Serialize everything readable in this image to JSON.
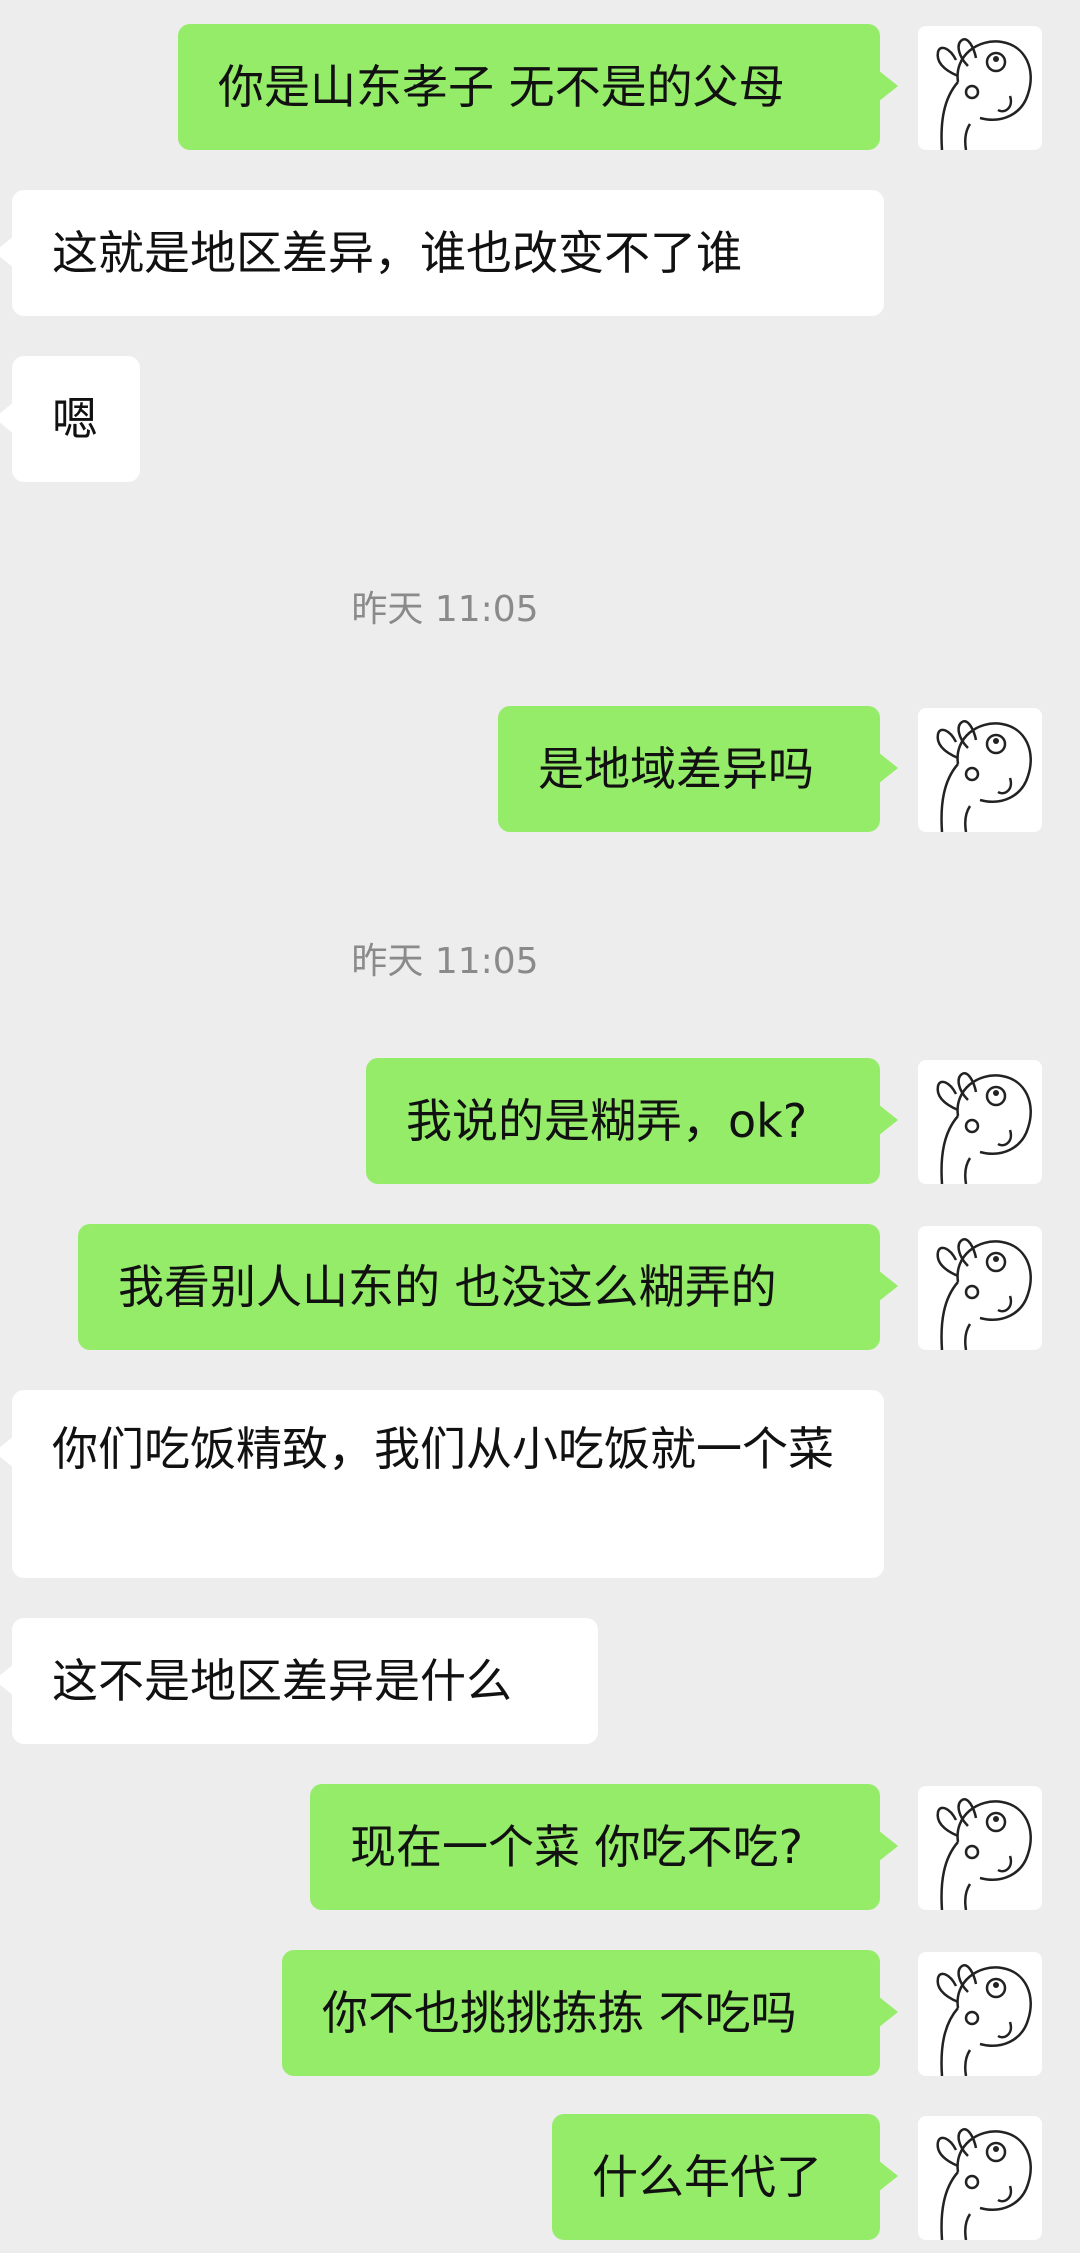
{
  "conversation": {
    "messages": [
      {
        "side": "out",
        "text": "你是山东孝子 无不是的父母"
      },
      {
        "side": "in",
        "text": "这就是地区差异，谁也改变不了谁"
      },
      {
        "side": "in",
        "text": "嗯"
      },
      {
        "type": "time",
        "text": "昨天 11:05"
      },
      {
        "side": "out",
        "text": "是地域差异吗"
      },
      {
        "type": "time",
        "text": "昨天 11:05"
      },
      {
        "side": "out",
        "text": "我说的是糊弄，ok?"
      },
      {
        "side": "out",
        "text": "我看别人山东的 也没这么糊弄的"
      },
      {
        "side": "in",
        "text": "你们吃饭精致，我们从小吃饭就一个菜"
      },
      {
        "side": "in",
        "text": "这不是地区差异是什么"
      },
      {
        "side": "out",
        "text": "现在一个菜 你吃不吃?"
      },
      {
        "side": "out",
        "text": "你不也挑挑拣拣 不吃吗"
      },
      {
        "side": "out",
        "text": "什么年代了"
      }
    ]
  },
  "avatar_icon": "cartoon-face-icon",
  "colors": {
    "background": "#ededed",
    "outgoing_bubble": "#95ec69",
    "incoming_bubble": "#ffffff",
    "timestamp_text": "#8a8a8a"
  }
}
